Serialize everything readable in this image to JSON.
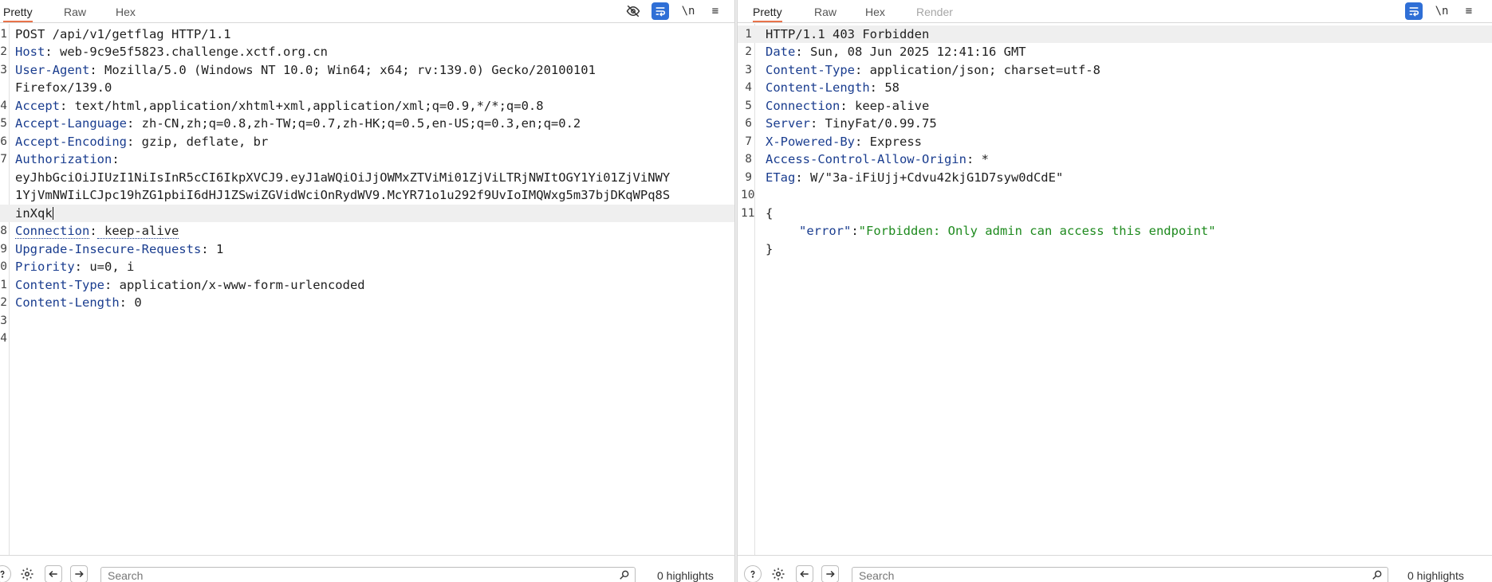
{
  "request": {
    "tabs": [
      {
        "label": "Pretty",
        "active": true
      },
      {
        "label": "Raw",
        "active": false
      },
      {
        "label": "Hex",
        "active": false
      }
    ],
    "toolbar": {
      "newline_label": "\\n",
      "menu_label": "≡"
    },
    "lines": [
      {
        "n": "1",
        "text": "POST /api/v1/getflag HTTP/1.1"
      },
      {
        "n": "2",
        "key": "Host",
        "value": " web-9c9e5f5823.challenge.xctf.org.cn"
      },
      {
        "n": "3",
        "key": "User-Agent",
        "value": " Mozilla/5.0 (Windows NT 10.0; Win64; x64; rv:139.0) Gecko/20100101"
      },
      {
        "n": "",
        "text": "Firefox/139.0"
      },
      {
        "n": "4",
        "key": "Accept",
        "value": " text/html,application/xhtml+xml,application/xml;q=0.9,*/*;q=0.8"
      },
      {
        "n": "5",
        "key": "Accept-Language",
        "value": " zh-CN,zh;q=0.8,zh-TW;q=0.7,zh-HK;q=0.5,en-US;q=0.3,en;q=0.2"
      },
      {
        "n": "6",
        "key": "Accept-Encoding",
        "value": " gzip, deflate, br"
      },
      {
        "n": "7",
        "key": "Authorization",
        "value": ""
      },
      {
        "n": "",
        "text": "eyJhbGciOiJIUzI1NiIsInR5cCI6IkpXVCJ9.eyJ1aWQiOiJjOWMxZTViMi01ZjViLTRjNWItOGY1Yi01ZjViNWY"
      },
      {
        "n": "",
        "text": "1YjVmNWIiLCJpc19hZG1pbiI6dHJ1ZSwiZGVidWciOnRydWV9.McYR71o1u292f9UvIoIMQWxg5m37bjDKqWPq8S"
      },
      {
        "n": "",
        "text": "inXqk"
      },
      {
        "n": "8",
        "key": "Connection",
        "value": " keep-alive"
      },
      {
        "n": "9",
        "key": "Upgrade-Insecure-Requests",
        "value": " 1"
      },
      {
        "n": "0",
        "key": "Priority",
        "value": " u=0, i"
      },
      {
        "n": "1",
        "key": "Content-Type",
        "value": " application/x-www-form-urlencoded"
      },
      {
        "n": "2",
        "key": "Content-Length",
        "value": " 0"
      },
      {
        "n": "3",
        "text": ""
      },
      {
        "n": "4",
        "text": ""
      }
    ],
    "search": {
      "placeholder": "Search"
    },
    "highlights": "0 highlights"
  },
  "response": {
    "tabs": [
      {
        "label": "Pretty",
        "active": true
      },
      {
        "label": "Raw",
        "active": false
      },
      {
        "label": "Hex",
        "active": false
      },
      {
        "label": "Render",
        "active": false
      }
    ],
    "toolbar": {
      "newline_label": "\\n",
      "menu_label": "≡"
    },
    "lines": [
      {
        "n": "1",
        "text": "HTTP/1.1 403 Forbidden"
      },
      {
        "n": "2",
        "key": "Date",
        "value": " Sun, 08 Jun 2025 12:41:16 GMT"
      },
      {
        "n": "3",
        "key": "Content-Type",
        "value": " application/json; charset=utf-8"
      },
      {
        "n": "4",
        "key": "Content-Length",
        "value": " 58"
      },
      {
        "n": "5",
        "key": "Connection",
        "value": " keep-alive"
      },
      {
        "n": "6",
        "key": "Server",
        "value": " TinyFat/0.99.75"
      },
      {
        "n": "7",
        "key": "X-Powered-By",
        "value": " Express"
      },
      {
        "n": "8",
        "key": "Access-Control-Allow-Origin",
        "value": " *"
      },
      {
        "n": "9",
        "key": "ETag",
        "value": " W/\"3a-iFiUjj+Cdvu42kjG1D7syw0dCdE\""
      },
      {
        "n": "10",
        "text": ""
      },
      {
        "n": "11",
        "text": "{"
      },
      {
        "n": "",
        "json_key": "\"error\"",
        "json_colon": ":",
        "json_value": "\"Forbidden: Only admin can access this endpoint\""
      },
      {
        "n": "",
        "text": "}"
      }
    ],
    "search": {
      "placeholder": "Search"
    },
    "highlights": "0 highlights"
  },
  "icons": {
    "hide": "eye-slash-icon",
    "wrap": "word-wrap-icon",
    "help": "help-icon",
    "settings": "gear-icon",
    "back": "arrow-left-icon",
    "forward": "arrow-right-icon",
    "search": "search-icon"
  },
  "colors": {
    "header_key": "#1a3d8f",
    "json_string": "#1e8a1e",
    "active_tab_underline": "#e8734a",
    "wrap_button": "#2f6fd6"
  }
}
